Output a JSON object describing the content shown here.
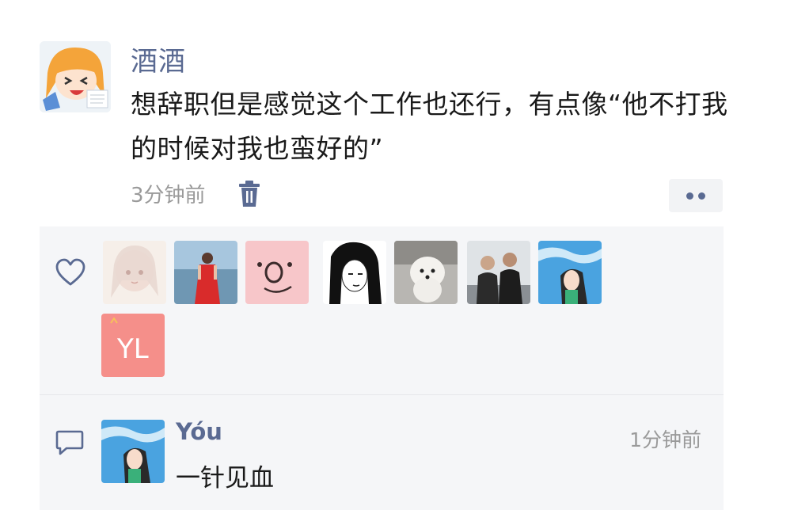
{
  "post": {
    "author": "酒酒",
    "text": "想辞职但是感觉这个工作也还行，有点像“他不打我的时候对我也蛮好的”",
    "time": "3分钟前",
    "avatar_icon": "anime-girl-avatar"
  },
  "likes": {
    "icon": "heart-icon",
    "users": [
      {
        "avatar": "sketch-girl-avatar"
      },
      {
        "avatar": "red-dress-photo-avatar"
      },
      {
        "avatar": "pink-face-avatar"
      },
      {
        "avatar": "ink-girl-avatar"
      },
      {
        "avatar": "white-dog-avatar"
      },
      {
        "avatar": "two-people-photo-avatar"
      },
      {
        "avatar": "sky-girl-avatar"
      },
      {
        "avatar": "yl-text-avatar",
        "text": "YL"
      }
    ]
  },
  "comments": [
    {
      "author": "Yóu",
      "text": "一针见血",
      "time": "1分钟前",
      "avatar": "sky-girl-avatar"
    }
  ],
  "colors": {
    "name_link": "#5a6a92",
    "panel_bg": "#f5f6f8",
    "muted_text": "#9a9a9a"
  }
}
